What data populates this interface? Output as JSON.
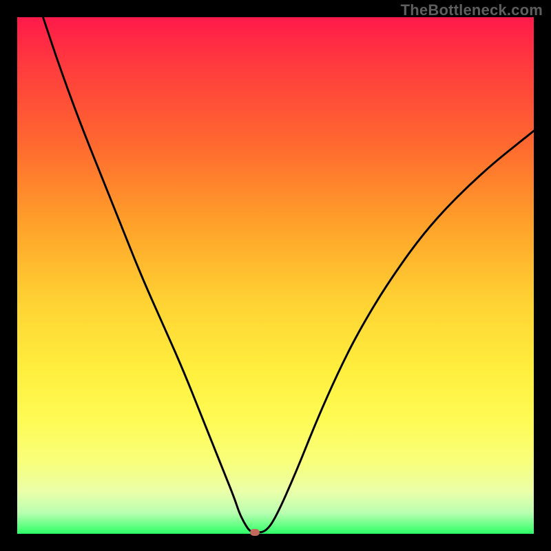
{
  "watermark": "TheBottleneck.com",
  "chart_data": {
    "type": "line",
    "title": "",
    "xlabel": "",
    "ylabel": "",
    "xlim": [
      0,
      100
    ],
    "ylim": [
      0,
      100
    ],
    "grid": false,
    "series": [
      {
        "name": "curve",
        "x": [
          5,
          8,
          12,
          16,
          20,
          24,
          28,
          32,
          36,
          38,
          40,
          42,
          43,
          44,
          45,
          46,
          48,
          50,
          54,
          58,
          62,
          66,
          72,
          80,
          90,
          100
        ],
        "y": [
          100,
          91,
          80,
          70,
          60,
          50,
          41,
          32,
          22,
          17,
          12,
          7,
          4,
          2,
          0.5,
          0.3,
          0.3,
          3,
          12,
          22,
          31,
          39,
          49,
          60,
          70,
          78
        ]
      }
    ],
    "annotations": [
      {
        "name": "min-marker",
        "x": 46,
        "y": 0.3,
        "color": "#c46a5c"
      }
    ],
    "background_gradient": {
      "top": "#ff1a4a",
      "bottom": "#2dff66"
    }
  }
}
